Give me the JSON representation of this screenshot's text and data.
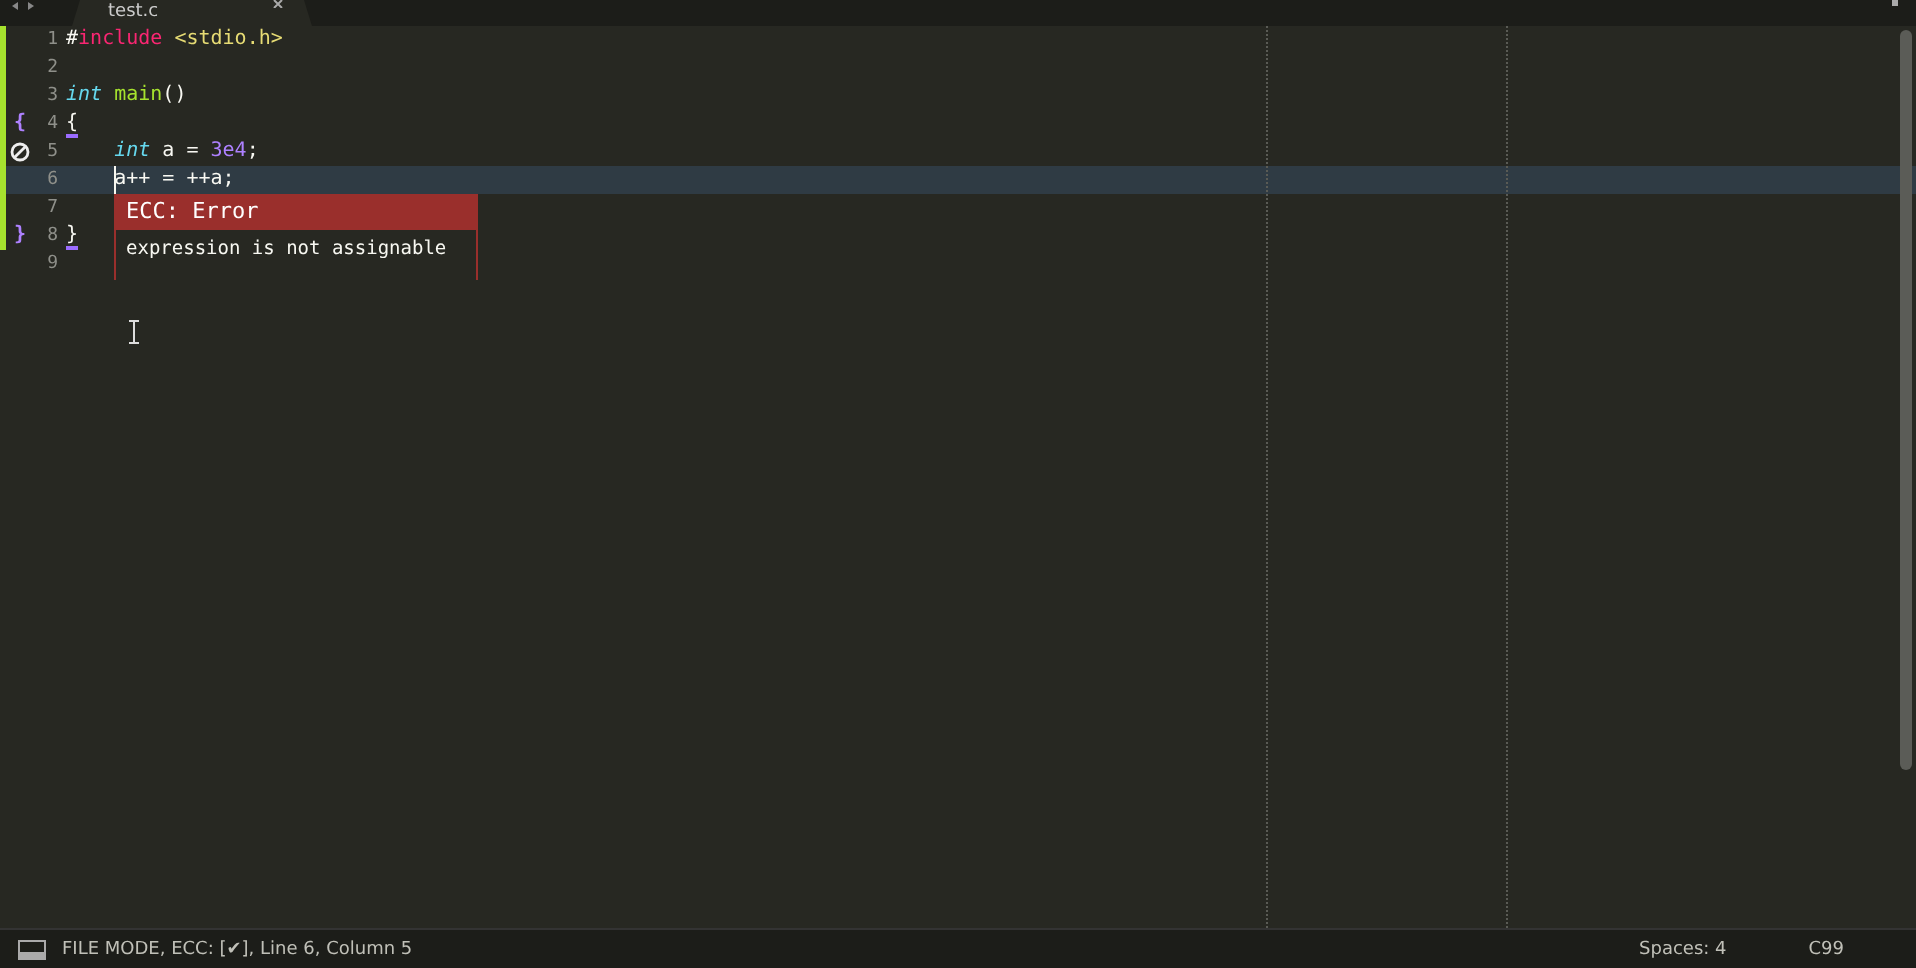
{
  "tab": {
    "title": "test.c"
  },
  "lines": [
    {
      "number": "1",
      "modified": true,
      "current": false,
      "tokens": [
        {
          "kind": "plain",
          "text": "#"
        },
        {
          "kind": "preproc",
          "text": "include"
        },
        {
          "kind": "string",
          "text": " <stdio.h>"
        }
      ]
    },
    {
      "number": "2",
      "modified": true,
      "current": false
    },
    {
      "number": "3",
      "modified": true,
      "current": false,
      "tokens": [
        {
          "kind": "type",
          "text": "int"
        },
        {
          "kind": "function",
          "text": " main"
        },
        {
          "kind": "plain",
          "text": "()"
        }
      ]
    },
    {
      "number": "4",
      "modified": true,
      "current": false,
      "mark": {
        "kind": "brace",
        "text": "{"
      },
      "tokens": [
        {
          "kind": "bracket",
          "text": "{"
        }
      ]
    },
    {
      "number": "5",
      "modified": true,
      "current": false,
      "mark": {
        "kind": "error"
      },
      "tokens": [
        {
          "kind": "type",
          "text": "    int"
        },
        {
          "kind": "plain",
          "text": " a = "
        },
        {
          "kind": "number",
          "text": "3e4"
        },
        {
          "kind": "plain",
          "text": ";"
        }
      ]
    },
    {
      "number": "6",
      "modified": true,
      "current": true,
      "tokens": [
        {
          "kind": "plain",
          "text": "    a++ = ++a;"
        }
      ]
    },
    {
      "number": "7",
      "modified": true,
      "current": false
    },
    {
      "number": "8",
      "modified": true,
      "current": false,
      "mark": {
        "kind": "brace",
        "text": "}"
      },
      "tokens": [
        {
          "kind": "bracket",
          "text": "}"
        }
      ]
    },
    {
      "number": "9",
      "modified": false,
      "current": false
    }
  ],
  "tooltip": {
    "title": "ECC: Error",
    "message": "expression is not assignable"
  },
  "status_bar": {
    "mode": "FILE MODE, ECC: [✔], Line 6, Column 5",
    "indentation": "Spaces: 4",
    "syntax": "C99"
  }
}
